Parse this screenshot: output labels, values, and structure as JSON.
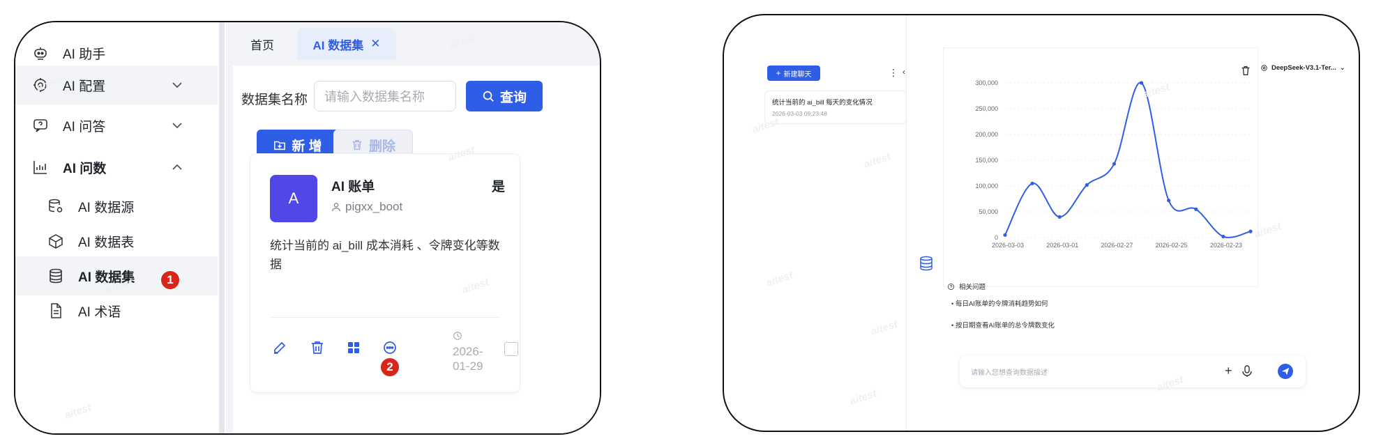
{
  "left": {
    "sidebar": {
      "items": [
        {
          "label": "AI 助手",
          "icon": "robot-icon"
        },
        {
          "label": "AI 配置",
          "icon": "ai-config-icon"
        },
        {
          "label": "AI 问答",
          "icon": "chat-question-icon"
        },
        {
          "label": "AI 问数",
          "icon": "bar-chart-icon"
        }
      ],
      "subitems": [
        {
          "label": "AI 数据源",
          "icon": "database-gear-icon"
        },
        {
          "label": "AI 数据表",
          "icon": "box-icon"
        },
        {
          "label": "AI 数据集",
          "icon": "database-icon"
        },
        {
          "label": "AI 术语",
          "icon": "document-icon"
        }
      ]
    },
    "badges": {
      "one": "1",
      "two": "2"
    },
    "tabs": {
      "home": "首页",
      "current": "AI 数据集"
    },
    "form": {
      "name_label": "数据集名称",
      "name_placeholder": "请输入数据集名称",
      "query_label": "查询",
      "add_label": "新 增",
      "delete_label": "删除"
    },
    "card": {
      "avatar": "A",
      "title": "AI 账单",
      "flag": "是",
      "owner": "pigxx_boot",
      "description": "统计当前的 ai_bill 成本消耗 、令牌变化等数据",
      "date_line1": "2026-",
      "date_line2": "01-29"
    },
    "colors": {
      "primary": "#2f5ee6",
      "badge": "#d9261c",
      "avatar": "#5147e6"
    }
  },
  "right": {
    "new_chat": "新建聊天",
    "history": {
      "title": "统计当前的 ai_bill 每天的变化情况",
      "time": "2026-03-03 09:23:48"
    },
    "model": "DeepSeek-V3.1-Ter...",
    "related_title": "相关问题",
    "related": [
      "每日AI账单的令牌消耗趋势如何",
      "按日期查看AI账单的总令牌数变化"
    ],
    "chat_placeholder": "请输入您想查询数据描述"
  },
  "watermark": "aitest",
  "chart_data": {
    "type": "line",
    "x": [
      "2026-03-03",
      "2026-03-02",
      "2026-03-01",
      "2026-02-28",
      "2026-02-27",
      "2026-02-26",
      "2026-02-25",
      "2026-02-24",
      "2026-02-23",
      "2026-02-22"
    ],
    "values": [
      5000,
      105000,
      40000,
      102000,
      143000,
      300000,
      72000,
      55000,
      2000,
      12000
    ],
    "xticks": [
      "2026-03-03",
      "2026-03-01",
      "2026-02-27",
      "2026-02-25",
      "2026-02-23"
    ],
    "yticks": [
      "0",
      "50,000",
      "100,000",
      "150,000",
      "200,000",
      "250,000",
      "300,000"
    ],
    "ylim": [
      0,
      300000
    ],
    "grid": true,
    "smooth": true,
    "color": "#2f5ee6"
  }
}
